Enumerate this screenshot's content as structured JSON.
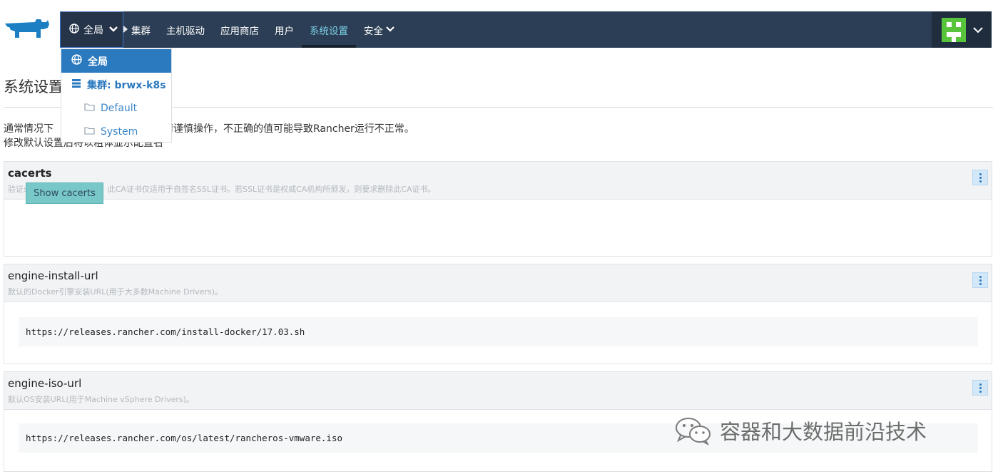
{
  "header": {
    "scope_label": "全局",
    "nav": [
      {
        "label": "集群"
      },
      {
        "label": "主机驱动"
      },
      {
        "label": "应用商店"
      },
      {
        "label": "用户"
      },
      {
        "label": "系统设置",
        "active": true
      },
      {
        "label": "安全"
      }
    ]
  },
  "dropdown": {
    "global": "全局",
    "cluster": "集群: brwx-k8s",
    "projects": [
      "Default",
      "System"
    ]
  },
  "page": {
    "title": "系统设置",
    "notice_line1_part1": "通常情况下",
    "notice_line1_part2": "。请谨慎操作，不正确的值可能导致Rancher运行不正常。",
    "notice_line2": "修改默认设置后将以粗体显示配置名"
  },
  "settings": [
    {
      "name": "cacerts",
      "desc": "验证ssl证书所需的CA证书，此CA证书仅适用于自签名SSL证书。若SSL证书是权威CA机构所颁发，则要求删除此CA证书。",
      "button": "Show cacerts"
    },
    {
      "name": "engine-install-url",
      "desc": "默认的Docker引擎安装URL(用于大多数Machine Drivers)。",
      "value": "https://releases.rancher.com/install-docker/17.03.sh"
    },
    {
      "name": "engine-iso-url",
      "desc": "默认OS安装URL(用于Machine vSphere Drivers)。",
      "value": "https://releases.rancher.com/os/latest/rancheros-vmware.iso"
    }
  ],
  "watermark": "容器和大数据前沿技术",
  "colors": {
    "nav_bg": "#2c3e55",
    "accent": "#2b79be",
    "active_nav": "#7ad0e6",
    "teal_button": "#79c8c8",
    "avatar_green": "#58c43c"
  }
}
